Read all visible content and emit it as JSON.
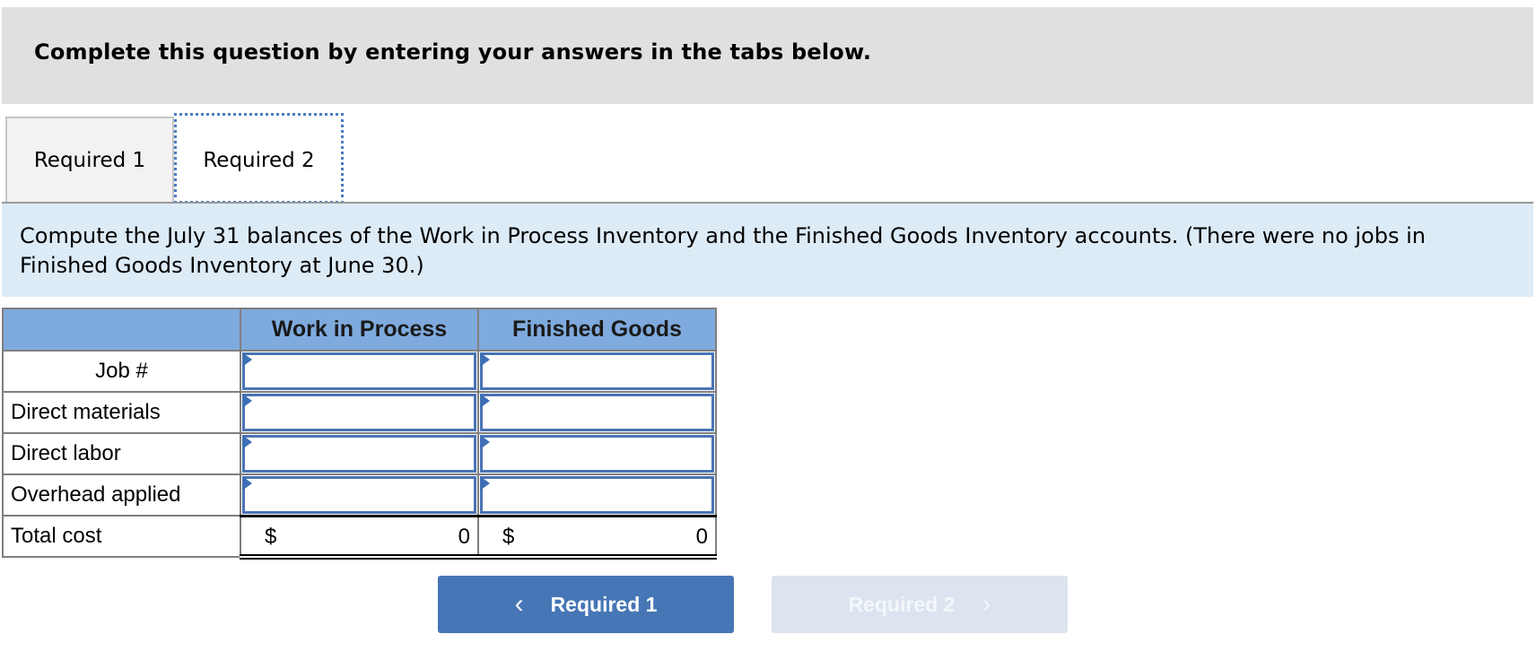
{
  "header": {
    "text": "Complete this question by entering your answers in the tabs below."
  },
  "tabs": [
    {
      "label": "Required 1",
      "active": false
    },
    {
      "label": "Required 2",
      "active": true
    }
  ],
  "instructions": "Compute the July 31 balances of the Work in Process Inventory and the Finished Goods Inventory accounts. (There were no jobs in Finished Goods Inventory at June 30.)",
  "table": {
    "columns": [
      "",
      "Work in Process",
      "Finished Goods"
    ],
    "rows": [
      {
        "label": "Job #",
        "values": [
          "",
          ""
        ]
      },
      {
        "label": "Direct materials",
        "values": [
          "",
          ""
        ]
      },
      {
        "label": "Direct labor",
        "values": [
          "",
          ""
        ]
      },
      {
        "label": "Overhead applied",
        "values": [
          "",
          ""
        ]
      }
    ],
    "total": {
      "label": "Total cost",
      "currency": "$",
      "values": [
        "0",
        "0"
      ]
    }
  },
  "nav": {
    "prev_label": "Required 1",
    "next_label": "Required 2",
    "prev_icon": "chevron-left-icon",
    "next_icon": "chevron-right-icon",
    "next_disabled": true
  },
  "colors": {
    "accent": "#4676b5",
    "header_bg": "#e0e0e0",
    "instruction_bg": "#ddebf7",
    "table_header_bg": "#7faadd"
  }
}
